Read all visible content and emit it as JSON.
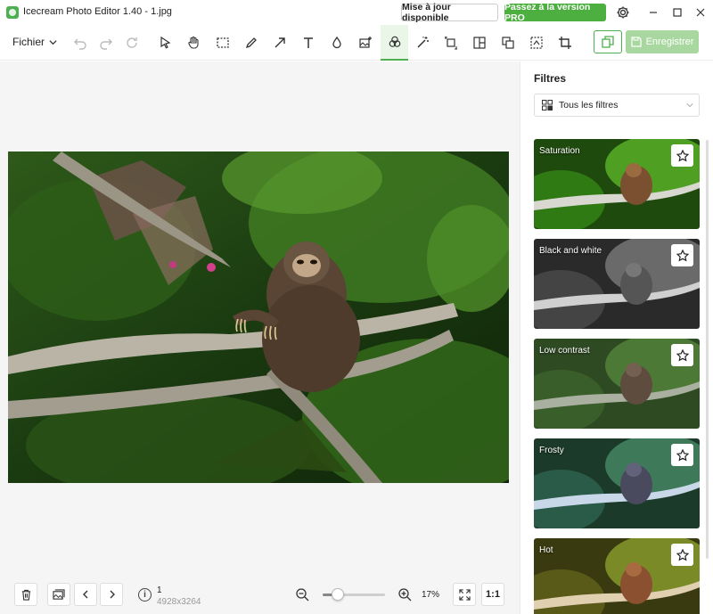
{
  "window": {
    "title": "Icecream Photo Editor 1.40 - 1.jpg",
    "update_label": "Mise à jour disponible",
    "pro_label": "Passez à la version PRO",
    "accent": "#4caf50"
  },
  "toolbar": {
    "file_label": "Fichier",
    "tools": [
      "undo-icon",
      "redo-icon",
      "reset-icon",
      "select-arrow-icon",
      "hand-icon",
      "marquee-icon",
      "pencil-icon",
      "arrow-icon",
      "text-icon",
      "drop-icon",
      "add-image-icon",
      "filters-icon",
      "magic-wand-icon",
      "resize-icon",
      "collage-icon",
      "layers-icon",
      "crop-selection-icon",
      "crop-icon"
    ],
    "active_tool": "filters-icon",
    "save_label": "Enregistrer"
  },
  "status": {
    "page": "1",
    "dimensions": "4928x3264",
    "zoom": "17%",
    "zoom_level": 0.17,
    "one_to_one": "1:1"
  },
  "filters_panel": {
    "title": "Filtres",
    "select_value": "Tous les filtres",
    "items": [
      {
        "label": "Saturation"
      },
      {
        "label": "Black and white"
      },
      {
        "label": "Low contrast"
      },
      {
        "label": "Frosty"
      },
      {
        "label": "Hot"
      }
    ]
  }
}
